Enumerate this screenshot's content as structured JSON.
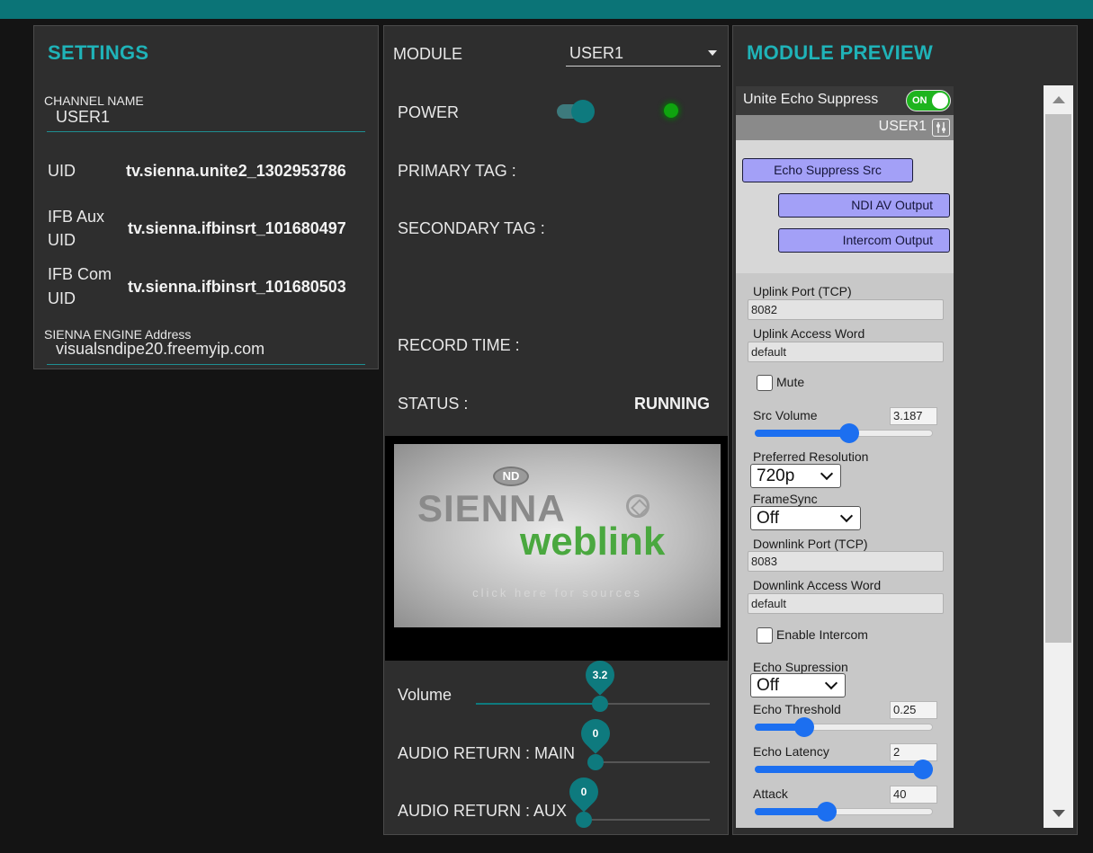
{
  "settings": {
    "title": "SETTINGS",
    "channel_name_label": "CHANNEL NAME",
    "channel_name_value": "USER1",
    "uid_label": "UID",
    "uid_value": "tv.sienna.unite2_1302953786",
    "ifb_aux_label_1": "IFB Aux",
    "ifb_aux_label_2": "UID",
    "ifb_aux_value": "tv.sienna.ifbinsrt_101680497",
    "ifb_com_label_1": "IFB Com",
    "ifb_com_label_2": "UID",
    "ifb_com_value": "tv.sienna.ifbinsrt_101680503",
    "engine_address_label": "SIENNA ENGINE Address",
    "engine_address_value": "visualsndipe20.freemyip.com"
  },
  "module": {
    "module_label": "MODULE",
    "module_selected": "USER1",
    "power_label": "POWER",
    "power_on": true,
    "primary_tag_label": "PRIMARY TAG :",
    "secondary_tag_label": "SECONDARY TAG :",
    "record_time_label": "RECORD TIME :",
    "status_label": "STATUS :",
    "status_value": "RUNNING",
    "video": {
      "badge": "ND",
      "logo_main": "SIENNA",
      "logo_sub": "weblink",
      "hint": "click here for sources"
    },
    "volume_label": "Volume",
    "volume_value": "3.2",
    "audio_main_label": "AUDIO RETURN : MAIN",
    "audio_main_value": "0",
    "audio_aux_label": "AUDIO RETURN : AUX",
    "audio_aux_value": "0"
  },
  "preview": {
    "title": "MODULE PREVIEW",
    "header_title": "Unite Echo Suppress",
    "on_label": "ON",
    "user_label": "USER1",
    "nodes": {
      "src": "Echo Suppress Src",
      "ndi": "NDI AV Output",
      "intercom": "Intercom Output"
    },
    "uplink_port_label": "Uplink Port (TCP)",
    "uplink_port_value": "8082",
    "uplink_word_label": "Uplink Access Word",
    "uplink_word_value": "default",
    "mute_label": "Mute",
    "src_volume_label": "Src Volume",
    "src_volume_value": "3.187",
    "resolution_label": "Preferred Resolution",
    "resolution_value": "720p",
    "framesync_label": "FrameSync",
    "framesync_value": "Off",
    "downlink_port_label": "Downlink Port (TCP)",
    "downlink_port_value": "8083",
    "downlink_word_label": "Downlink Access Word",
    "downlink_word_value": "default",
    "intercom_label": "Enable Intercom",
    "echo_supp_label": "Echo Supression",
    "echo_supp_value": "Off",
    "echo_threshold_label": "Echo Threshold",
    "echo_threshold_value": "0.25",
    "echo_latency_label": "Echo Latency",
    "echo_latency_value": "2",
    "attack_label": "Attack",
    "attack_value": "40"
  },
  "colors": {
    "accent": "#1fb3b8",
    "teal": "#0e7a7e",
    "status_led": "#0fa40f",
    "node_fill": "#a3a0f7",
    "slider_blue": "#1c6ff0"
  }
}
